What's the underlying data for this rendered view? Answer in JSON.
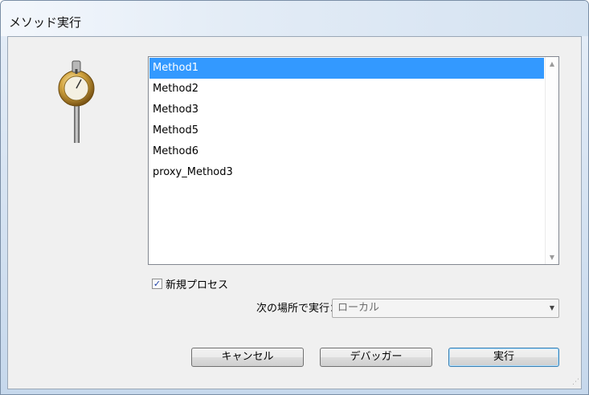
{
  "window": {
    "title": "メソッド実行"
  },
  "methods": {
    "items": [
      "Method1",
      "Method2",
      "Method3",
      "Method5",
      "Method6",
      "proxy_Method3"
    ],
    "selected_index": 0
  },
  "new_process": {
    "label": "新規プロセス",
    "checked": true
  },
  "run_location": {
    "label": "次の場所で実行：",
    "value": "ローカル"
  },
  "buttons": {
    "cancel": "キャンセル",
    "debugger": "デバッガー",
    "run": "実行"
  },
  "icons": {
    "app": "gauge-lamp-icon",
    "scroll_up": "chevron-up-icon",
    "scroll_down": "chevron-down-icon",
    "dropdown": "chevron-down-icon",
    "checkbox_mark": "check-icon"
  }
}
